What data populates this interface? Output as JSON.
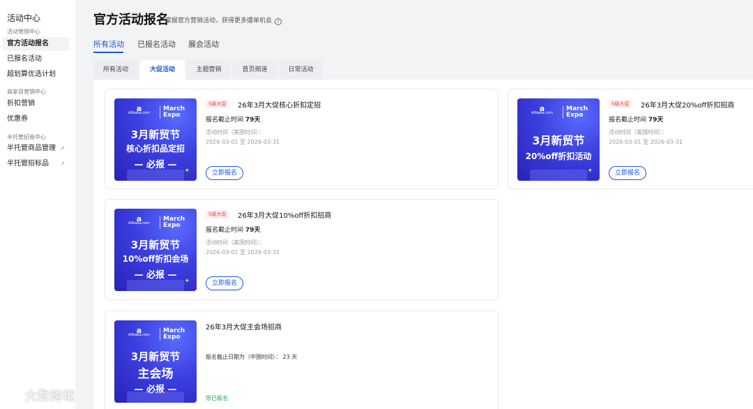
{
  "sidebar": {
    "title": "活动中心",
    "groups": [
      {
        "label": "活动营销中心",
        "items": [
          {
            "label": "官方活动报名"
          },
          {
            "label": "已报名活动"
          },
          {
            "label": "超划算优选计划"
          }
        ]
      },
      {
        "label": "商家自营销中心",
        "items": [
          {
            "label": "折扣营销"
          },
          {
            "label": "优惠券"
          }
        ]
      },
      {
        "label": "半托管招商中心",
        "items": [
          {
            "label": "半托管商品管理"
          },
          {
            "label": "半托管招标品"
          }
        ]
      }
    ],
    "external_icon": "↗"
  },
  "header": {
    "title": "官方活动报名",
    "subtitle": "掌握官方营销活动，获得更多爆单机会",
    "help_glyph": "?"
  },
  "top_tabs": [
    {
      "label": "所有活动"
    },
    {
      "label": "已报名活动"
    },
    {
      "label": "展会活动"
    }
  ],
  "sub_tabs": [
    {
      "label": "所有活动"
    },
    {
      "label": "大促活动"
    },
    {
      "label": "主题营销"
    },
    {
      "label": "首页频道"
    },
    {
      "label": "日常活动"
    }
  ],
  "thumb_common": {
    "logo_mark": "a",
    "logo_text": "Alibaba.com",
    "expo": "March\nExpo",
    "spark": "✦"
  },
  "cards": [
    {
      "badge": "S级大促",
      "title": "26年3月大促核心折扣定招",
      "deadline_label": "报名截止时间 ",
      "deadline_value": "79天",
      "time_label": "活动时间（美国时间）：",
      "time_range": "2026-03-01 至 2026-03-31",
      "button": "立即报名",
      "thumb": {
        "line1": "3月新贸节",
        "line2": "核心折扣品定招",
        "line3": "— 必报 —"
      }
    },
    {
      "badge": "S级大促",
      "title": "26年3月大促20%off折扣招商",
      "deadline_label": "报名截止时间 ",
      "deadline_value": "79天",
      "time_label": "活动时间（美国时间）：",
      "time_range": "2026-03-01 至 2026-03-31",
      "button": "立即报名",
      "thumb": {
        "line1": "3月新贸节",
        "line2": "20%off折扣活动"
      }
    },
    {
      "badge": "S级大促",
      "title": "26年3月大促10%off折扣招商",
      "deadline_label": "报名截止时间 ",
      "deadline_value": "79天",
      "time_label": "活动时间（美国时间）：",
      "time_range": "2026-03-01 至 2026-03-31",
      "button": "立即报名",
      "thumb": {
        "line1": "3月新贸节",
        "line2": "10%off折扣会场",
        "line3": "— 必报 —"
      }
    },
    {
      "title": "26年3月大促主会场招商",
      "deadline_text": "报名截止日期为（中国时间）： 23 天",
      "status": "您已报名",
      "thumb": {
        "line1": "3月新贸节",
        "line2": "主会场",
        "line3": "— 必报 —"
      }
    }
  ],
  "watermark": "大数跨境"
}
